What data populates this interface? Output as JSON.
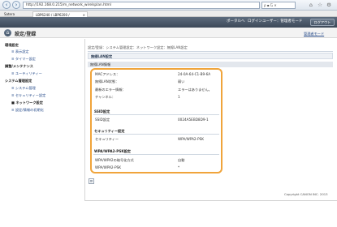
{
  "browser": {
    "url": "http://192.168.0.215/m_network_wirelsplan.html",
    "url_tail": "ρ ▪ Ⴚ ✕",
    "tabs": [
      "Satera",
      "LBP6240 / LBP6200 /"
    ],
    "tab_close": "×"
  },
  "header": {
    "portal_link": "ポータルへ",
    "login_user": "ログインユーザー：管理者モード",
    "logout": "ログアウト"
  },
  "mode": {
    "title": "設定/登録",
    "link": "管理者モード"
  },
  "sidebar": {
    "items": [
      {
        "label": "環境設定",
        "type": "head"
      },
      {
        "label": "表示設定",
        "type": "link"
      },
      {
        "label": "タイマー設定",
        "type": "link"
      },
      {
        "label": "調整/メンテナンス",
        "type": "head"
      },
      {
        "label": "ユーティリティー",
        "type": "link"
      },
      {
        "label": "システム管理設定",
        "type": "head"
      },
      {
        "label": "システム管理",
        "type": "link"
      },
      {
        "label": "セキュリティー設定",
        "type": "link"
      },
      {
        "label": "ネットワーク設定",
        "type": "link-current"
      },
      {
        "label": "設定/情報の初期化",
        "type": "link"
      }
    ]
  },
  "main": {
    "breadcrumb": "設定/登録：システム管理設定：ネットワーク設定：無線LAN設定",
    "page_title": "無線LAN設定",
    "info_title": "無線LAN情報",
    "general_rows": [
      {
        "label": "MACアドレス：",
        "value": "24-0A-64-C1-B9-6A"
      },
      {
        "label": "無線LAN状態：",
        "value": "弱い"
      },
      {
        "label": "最新のエラー情報：",
        "value": "エラーはありません。"
      },
      {
        "label": "チャンネル：",
        "value": "1"
      }
    ],
    "ssid_section": "SSID設定",
    "ssid_rows": [
      {
        "label": "SSID設定",
        "value": "0024A5EBD8D9-1"
      }
    ],
    "security_section": "セキュリティー設定",
    "security_rows": [
      {
        "label": "セキュリティー",
        "value": "WPA/WPA2-PSK"
      }
    ],
    "wpa_section": "WPA/WPA2-PSK設定",
    "wpa_rows": [
      {
        "label": "WPA/WPA2の暗号化方式",
        "value": "自動"
      },
      {
        "label": "WPA/WPA2-PSK",
        "value": "*"
      }
    ],
    "bottom_icon": "≡"
  },
  "footer": {
    "copyright": "Copyright CANON INC. 2013"
  }
}
